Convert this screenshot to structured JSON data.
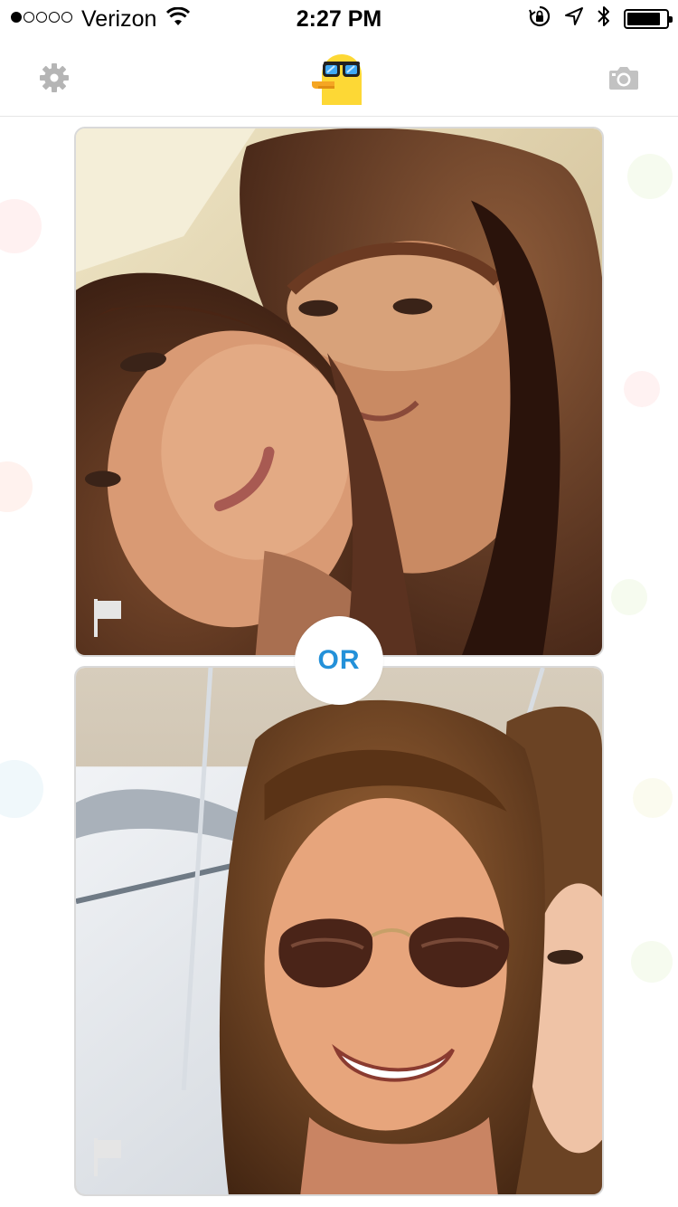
{
  "status_bar": {
    "carrier": "Verizon",
    "time": "2:27 PM",
    "signal_bars_filled": 1,
    "signal_bars_total": 5,
    "battery_level": 0.85
  },
  "nav": {
    "left_icon": "gear-icon",
    "center_logo": "duck-with-sunglasses-logo",
    "right_icon": "camera-icon"
  },
  "vote": {
    "separator_label": "OR",
    "cards": [
      {
        "flag_icon": "flag-icon"
      },
      {
        "flag_icon": "flag-icon"
      }
    ]
  },
  "colors": {
    "accent": "#2491d9",
    "icon_gray": "#b5b5b5",
    "logo_yellow": "#fdd835",
    "logo_beak": "#f5a623"
  }
}
